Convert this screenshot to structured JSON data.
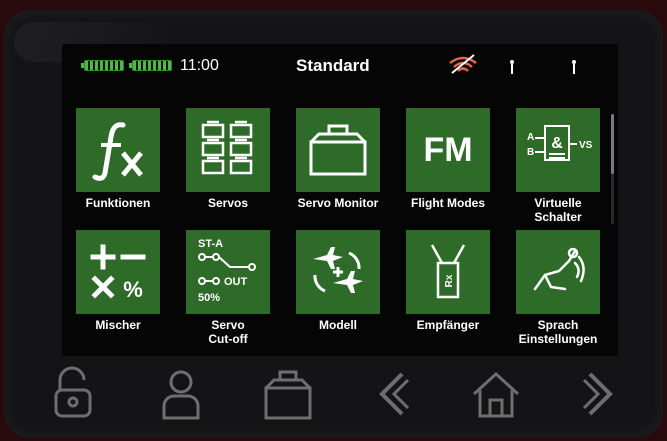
{
  "statusbar": {
    "time": "11:00",
    "title": "Standard",
    "icons": [
      "battery-transmitter-icon",
      "battery-receiver-icon",
      "signal-icon",
      "antenna-icon",
      "antenna-icon"
    ]
  },
  "tiles": [
    {
      "label": "Funktionen",
      "icon": "function-icon"
    },
    {
      "label": "Servos",
      "icon": "servos-icon"
    },
    {
      "label": "Servo Monitor",
      "icon": "servo-monitor-icon"
    },
    {
      "label": "Flight Modes",
      "icon": "flight-modes-icon",
      "icon_text": "FM"
    },
    {
      "label": "Virtuelle\nSchalter",
      "icon": "virtual-switch-icon"
    },
    {
      "label": "Mischer",
      "icon": "mixer-icon"
    },
    {
      "label": "Servo\nCut-off",
      "icon": "servo-cutoff-icon",
      "icon_text": [
        "ST-A",
        "OUT",
        "50%"
      ]
    },
    {
      "label": "Modell",
      "icon": "model-icon"
    },
    {
      "label": "Empfänger",
      "icon": "receiver-icon",
      "icon_text": "Rx"
    },
    {
      "label": "Sprach\nEinstellungen",
      "icon": "voice-settings-icon"
    }
  ],
  "navbar": [
    "unlock-icon",
    "user-icon",
    "model-case-icon",
    "back-icon",
    "home-icon",
    "forward-icon"
  ],
  "colors": {
    "tile_green": "#2e6b29",
    "battery_green": "#4dbb3f",
    "nav_gray": "#6e6e6e"
  }
}
